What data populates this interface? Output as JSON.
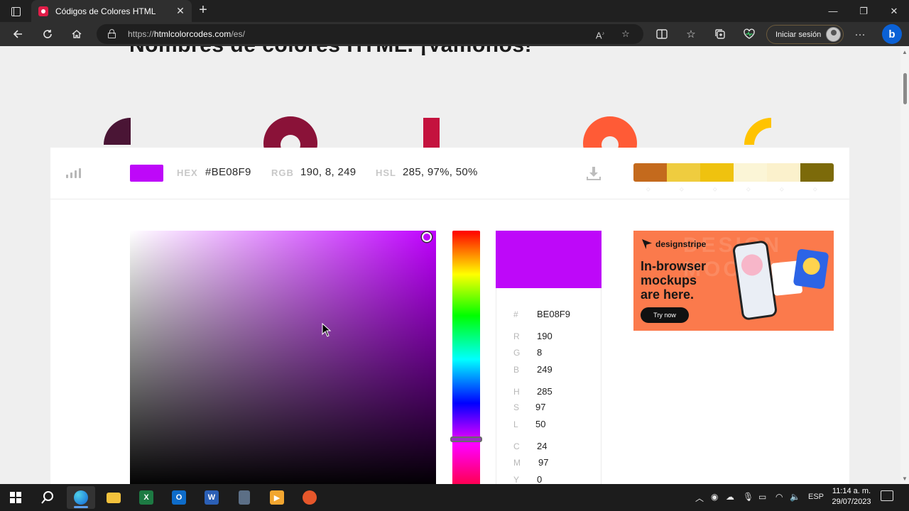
{
  "browser": {
    "tab_title": "Códigos de Colores HTML",
    "tab_close": "✕",
    "new_tab": "+",
    "url_prefix": "https://",
    "url_host": "htmlcolorcodes.com",
    "url_path": "/es/",
    "signin_label": "Iniciar sesión",
    "window": {
      "minimize": "—",
      "maximize": "❐",
      "close": "✕"
    }
  },
  "page": {
    "heading_partial": "Nombres de colores HTML. ¡Vamonos!",
    "shape_colors": [
      "#4a1535",
      "#8a1238",
      "#c4123e",
      "#ff5b36",
      "#ffc300"
    ]
  },
  "picker": {
    "selected_color": "#BE08F9",
    "hex_label": "HEX",
    "hex_value": "#BE08F9",
    "rgb_label": "RGB",
    "rgb_value": "190, 8, 249",
    "hsl_label": "HSL",
    "hsl_value": "285, 97%, 50%",
    "palette": [
      "#c46a1d",
      "#efcc3f",
      "#efc20f",
      "#fbf5d6",
      "#fbf1cc",
      "#7c6a0a"
    ],
    "hue_value": 285,
    "values": [
      {
        "key": "#",
        "value": "BE08F9"
      },
      {
        "key": "R",
        "value": "190"
      },
      {
        "key": "G",
        "value": "8"
      },
      {
        "key": "B",
        "value": "249"
      },
      {
        "key": "H",
        "value": "285"
      },
      {
        "key": "S",
        "value": "97"
      },
      {
        "key": "L",
        "value": "50"
      },
      {
        "key": "C",
        "value": "24"
      },
      {
        "key": "M",
        "value": "97"
      },
      {
        "key": "Y",
        "value": "0"
      }
    ]
  },
  "ad": {
    "brand": "designstripe",
    "headline_1": "In-browser",
    "headline_2": "mockups",
    "headline_3": "are here.",
    "cta": "Try now",
    "bg_text": "DESIGN MOCKUPS"
  },
  "taskbar": {
    "language": "ESP",
    "time": "11:14 a. m.",
    "date": "29/07/2023"
  }
}
